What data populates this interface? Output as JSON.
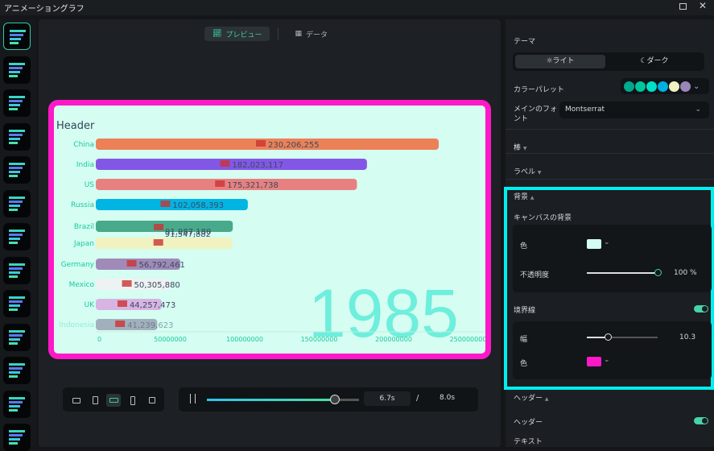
{
  "window": {
    "title": "アニメーショングラフ"
  },
  "sidebar": {
    "items": [
      "horizontal-bar-race",
      "donut",
      "grouped-column",
      "column",
      "stacked-column",
      "horizontal-bar",
      "stacked-horizontal-bar",
      "line",
      "multi-line",
      "area",
      "stacked-area",
      "pie",
      "donut-2"
    ]
  },
  "tabs": {
    "preview": "プレビュー",
    "data": "データ"
  },
  "chart_data": {
    "type": "bar",
    "orientation": "horizontal",
    "title": "Header",
    "year_label": "1985",
    "categories": [
      "China",
      "India",
      "US",
      "Russia",
      "Brazil",
      "Japan",
      "Germany",
      "Mexico",
      "UK",
      "Indonesia"
    ],
    "values": [
      230206255,
      182023117,
      175321738,
      102058393,
      91987180,
      91547882,
      56792461,
      50305880,
      44257473,
      41239623
    ],
    "value_labels": [
      "230,206,255",
      "182,023,117",
      "175,321,738",
      "102,058,393",
      "91,987,180",
      "91,547,882",
      "56,792,461",
      "50,305,880",
      "44,257,473",
      "41,239,623"
    ],
    "colors": [
      "#ec8158",
      "#8357e6",
      "#e88080",
      "#00b4e4",
      "#48aa8a",
      "#f0f2c0",
      "#a08bb8",
      "#eef2f2",
      "#d8b4e2",
      "#959cb0"
    ],
    "xticks": [
      "0",
      "50000000",
      "100000000",
      "150000000",
      "200000000",
      "250000000"
    ],
    "xlim": [
      0,
      250000000
    ],
    "background": "#d5fdf1",
    "border_color": "#ff18c8",
    "label_color": "#18c9a0",
    "year_color": "#6eeedd"
  },
  "playback": {
    "current": "6.7s",
    "separator": "/",
    "total": "8.0s",
    "progress": 0.84
  },
  "panel": {
    "theme_label": "テーマ",
    "light": "ライト",
    "dark": "ダーク",
    "palette_label": "カラーパレット",
    "palette": [
      "#00a88e",
      "#00c59a",
      "#00e0c8",
      "#00b0e0",
      "#f2f3c0",
      "#9b86b9"
    ],
    "font_label": "メインのフォント",
    "font_value": "Montserrat",
    "bar_section": "棒",
    "label_section": "ラベル",
    "bg_section": "背景",
    "canvas_bg": "キャンバスの背景",
    "color_label": "色",
    "bg_color": "#d5fdf1",
    "opacity_label": "不透明度",
    "opacity_value": "100 %",
    "opacity": 1.0,
    "border_label": "境界線",
    "width_label": "幅",
    "width_value": "10.3",
    "width_fraction": 0.3,
    "border_color_label": "色",
    "border_color": "#ff18c8",
    "header_section": "ヘッダー",
    "header_toggle": "ヘッダー",
    "text_label": "テキスト"
  }
}
